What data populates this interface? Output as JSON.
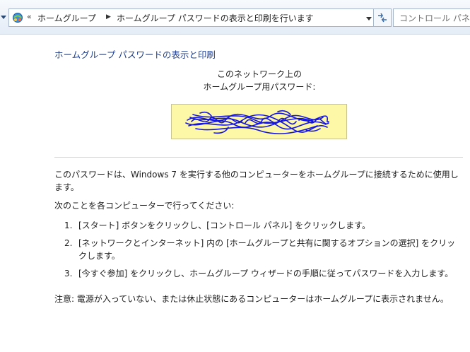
{
  "address_bar": {
    "overflow_chevron": "«",
    "breadcrumbs": [
      "ホームグループ",
      "ホームグループ パスワードの表示と印刷を行います"
    ],
    "search_placeholder": "コントロール パネル"
  },
  "main": {
    "title": "ホームグループ パスワードの表示と印刷",
    "network_label_line1": "このネットワーク上の",
    "network_label_line2": "ホームグループ用パスワード:",
    "description": "このパスワードは、Windows 7 を実行する他のコンピューターをホームグループに接続するために使用します。",
    "instruction": "次のことを各コンピューターで行ってください:",
    "steps": [
      {
        "num": "1.",
        "text": "[スタート] ボタンをクリックし、[コントロール パネル] をクリックします。"
      },
      {
        "num": "2.",
        "text": "[ネットワークとインターネット] 内の [ホームグループと共有に関するオプションの選択] をクリックします。"
      },
      {
        "num": "3.",
        "text": "[今すぐ参加] をクリックし、ホームグループ ウィザードの手順に従ってパスワードを入力します。"
      }
    ],
    "note": "注意: 電源が入っていない、または休止状態にあるコンピューターはホームグループに表示されません。"
  },
  "colors": {
    "title_link": "#1e3f8f",
    "password_bg": "#fdf7a8",
    "scribble": "#1515e0"
  },
  "icons": [
    "back-caret-icon",
    "homegroup-icon",
    "chevron-right-icon",
    "dropdown-arrow-icon",
    "refresh-icon"
  ]
}
